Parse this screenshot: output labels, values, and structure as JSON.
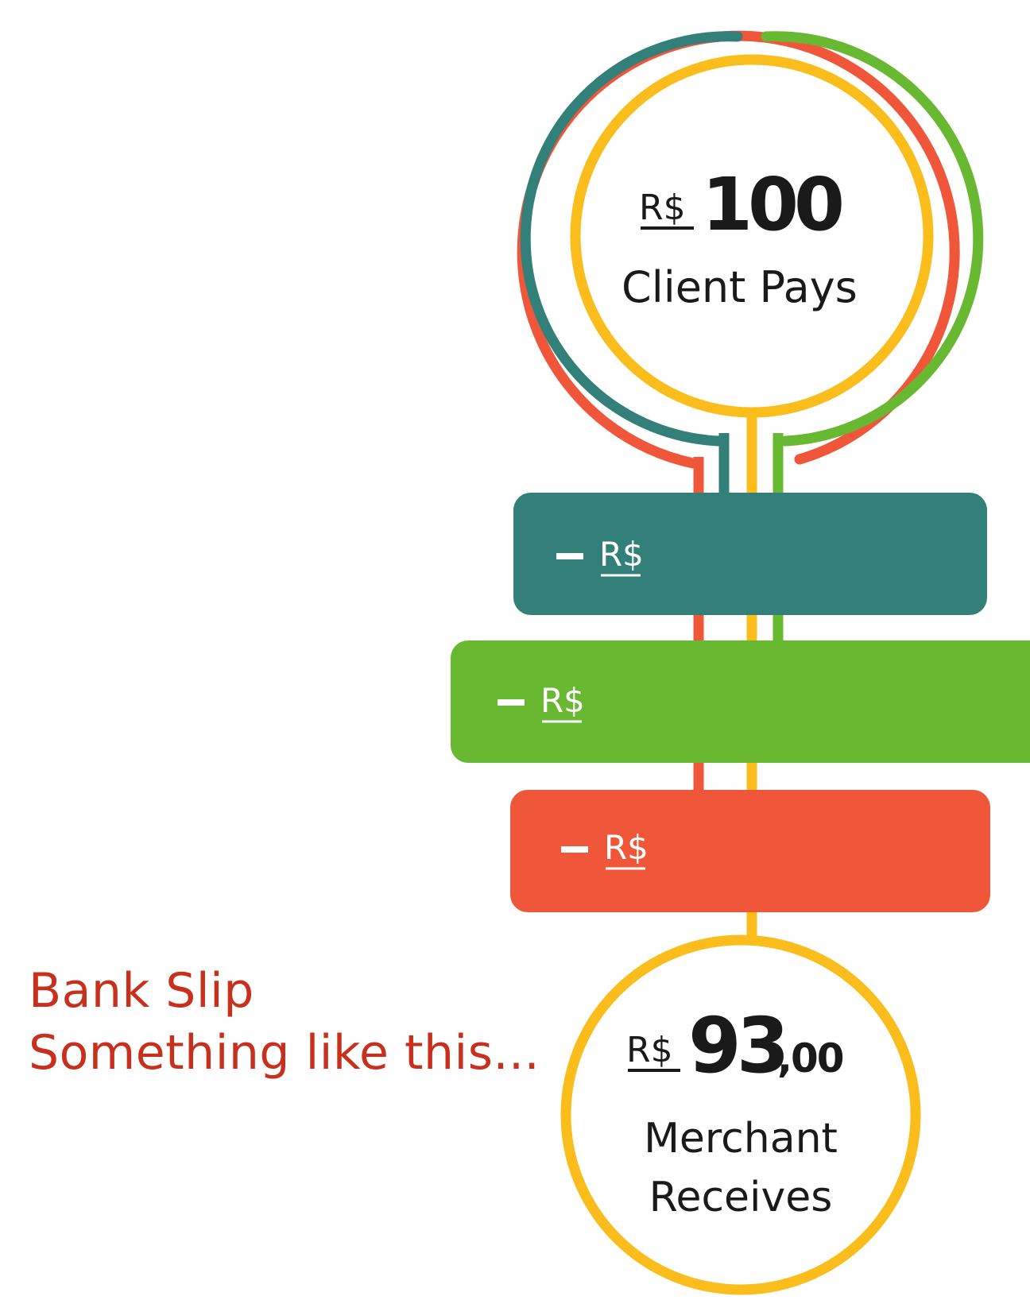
{
  "colors": {
    "red": "#f0573a",
    "teal": "#33807a",
    "green": "#68b832",
    "yellow": "#fbbd1b",
    "text_dark": "#1a1a1a",
    "caption_red": "#c8301e",
    "white": "#ffffff"
  },
  "top_node": {
    "currency": "R$",
    "amount": "100",
    "label": "Client Pays"
  },
  "deductions": [
    {
      "color_key": "teal",
      "sign": "–",
      "currency": "R$"
    },
    {
      "color_key": "green",
      "sign": "–",
      "currency": "R$"
    },
    {
      "color_key": "red",
      "sign": "–",
      "currency": "R$"
    }
  ],
  "bottom_node": {
    "currency": "R$",
    "amount_main": "93",
    "amount_cents": ",00",
    "label_line1": "Merchant",
    "label_line2": "Receives"
  },
  "caption": {
    "line1": "Bank Slip",
    "line2": "Something like this..."
  }
}
